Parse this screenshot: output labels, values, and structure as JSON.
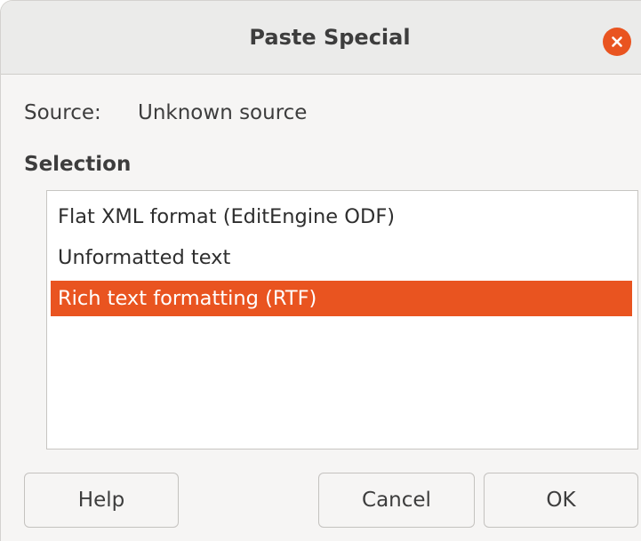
{
  "dialog": {
    "title": "Paste Special",
    "close_icon": "close-icon",
    "accent_color": "#e95420"
  },
  "source": {
    "label": "Source:",
    "value": "Unknown source"
  },
  "selection": {
    "heading": "Selection",
    "items": [
      {
        "label": "Flat XML format (EditEngine ODF)",
        "selected": false
      },
      {
        "label": "Unformatted text",
        "selected": false
      },
      {
        "label": "Rich text formatting (RTF)",
        "selected": true
      }
    ]
  },
  "buttons": {
    "help": "Help",
    "cancel": "Cancel",
    "ok": "OK"
  }
}
